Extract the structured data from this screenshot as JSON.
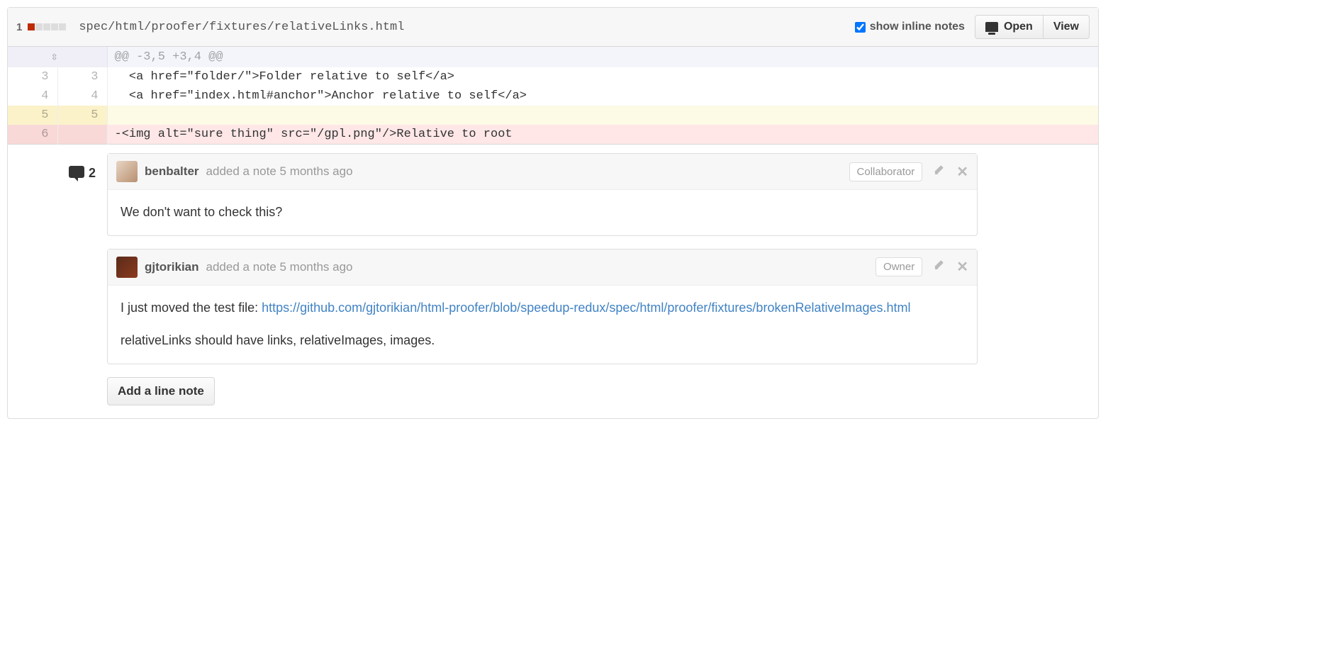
{
  "header": {
    "diffstat_num": "1",
    "file_path": "spec/html/proofer/fixtures/relativeLinks.html",
    "show_inline_notes_label": "show inline notes",
    "open_label": "Open",
    "view_label": "View"
  },
  "hunk": "@@ -3,5 +3,4 @@",
  "lines": [
    {
      "old": "3",
      "new": "3",
      "type": "ctx",
      "code": "  <a href=\"folder/\">Folder relative to self</a>"
    },
    {
      "old": "4",
      "new": "4",
      "type": "ctx",
      "code": "  <a href=\"index.html#anchor\">Anchor relative to self</a>"
    },
    {
      "old": "5",
      "new": "5",
      "type": "empty",
      "code": ""
    },
    {
      "old": "6",
      "new": "",
      "type": "del",
      "code": "-<img alt=\"sure thing\" src=\"/gpl.png\"/>Relative to root"
    }
  ],
  "comment_count": "2",
  "comments": [
    {
      "author": "benbalter",
      "meta": "added a note 5 months ago",
      "role": "Collaborator",
      "body_text": "We don't want to check this?"
    },
    {
      "author": "gjtorikian",
      "meta": "added a note 5 months ago",
      "role": "Owner",
      "body_prefix": "I just moved the test file: ",
      "body_link": "https://github.com/gjtorikian/html-proofer/blob/speedup-redux/spec/html/proofer/fixtures/brokenRelativeImages.html",
      "body_p2": "relativeLinks should have links, relativeImages, images."
    }
  ],
  "add_note_label": "Add a line note"
}
